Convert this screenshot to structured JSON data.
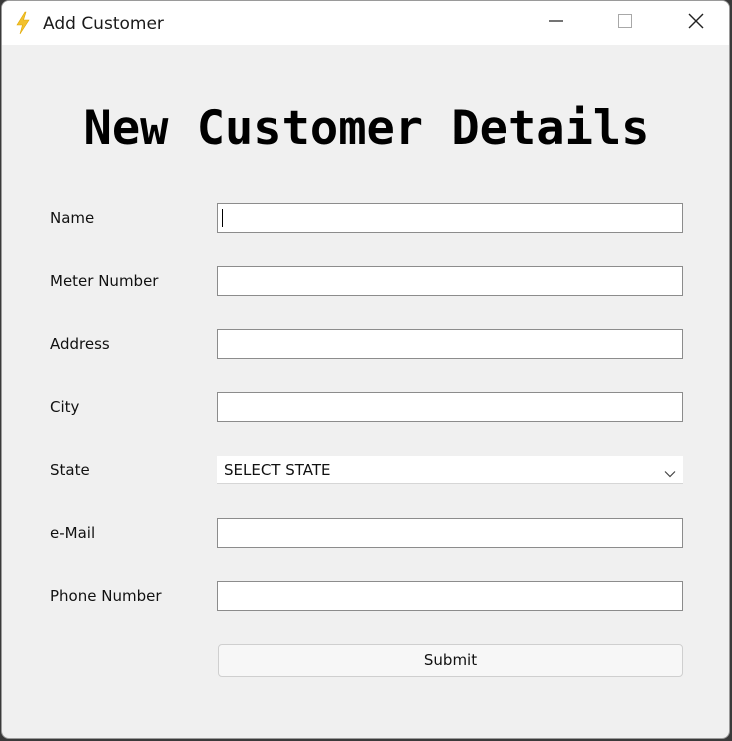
{
  "window": {
    "title": "Add Customer",
    "icon": "lightning-bolt-icon"
  },
  "controls": {
    "minimize": "minimize-icon",
    "maximize": "maximize-icon",
    "close": "close-icon"
  },
  "form": {
    "heading": "New Customer Details",
    "fields": [
      {
        "label": "Name",
        "value": ""
      },
      {
        "label": "Meter Number",
        "value": ""
      },
      {
        "label": "Address",
        "value": ""
      },
      {
        "label": "City",
        "value": ""
      },
      {
        "label": "State",
        "selected": "SELECT STATE"
      },
      {
        "label": "e-Mail",
        "value": ""
      },
      {
        "label": "Phone Number",
        "value": ""
      }
    ],
    "submit_label": "Submit"
  },
  "colors": {
    "bolt": "#f2c12e",
    "window_bg": "#f0f0f0",
    "titlebar_bg": "#ffffff"
  }
}
